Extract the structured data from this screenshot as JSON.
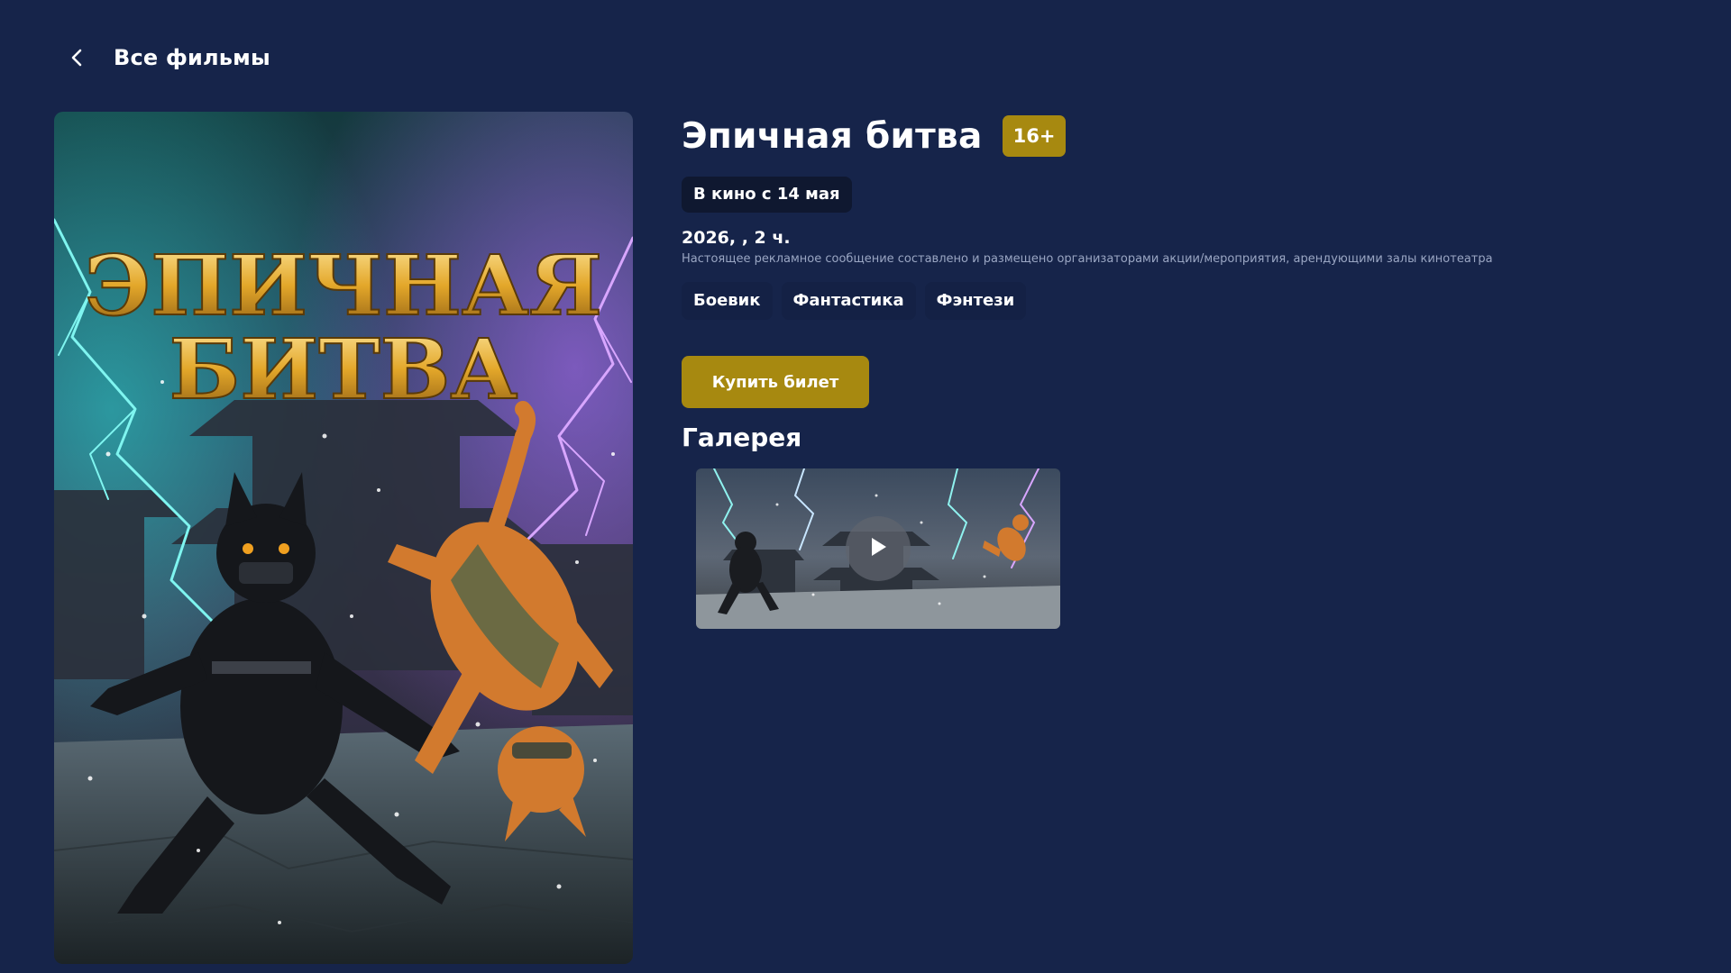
{
  "nav": {
    "back_label": "Все фильмы",
    "back_icon": "chevron-left-icon"
  },
  "poster": {
    "title_line1": "ЭПИЧНАЯ",
    "title_line2": "БИТВА"
  },
  "movie": {
    "title": "Эпичная битва",
    "age_rating": "16+",
    "release": "В кино с 14 мая",
    "meta": "2026, , 2 ч.",
    "disclaimer": "Настоящее рекламное сообщение составлено и размещено организаторами акции/мероприятия, арендующими залы кинотеатра",
    "genres": [
      "Боевик",
      "Фантастика",
      "Фэнтези"
    ]
  },
  "actions": {
    "buy_label": "Купить билет"
  },
  "gallery": {
    "heading": "Галерея",
    "items": [
      {
        "type": "video",
        "icon": "play-icon"
      }
    ]
  },
  "colors": {
    "background": "#16244a",
    "accent": "#a78910",
    "pill_dark": "#0f1830",
    "muted_text": "#9aa6c3"
  }
}
